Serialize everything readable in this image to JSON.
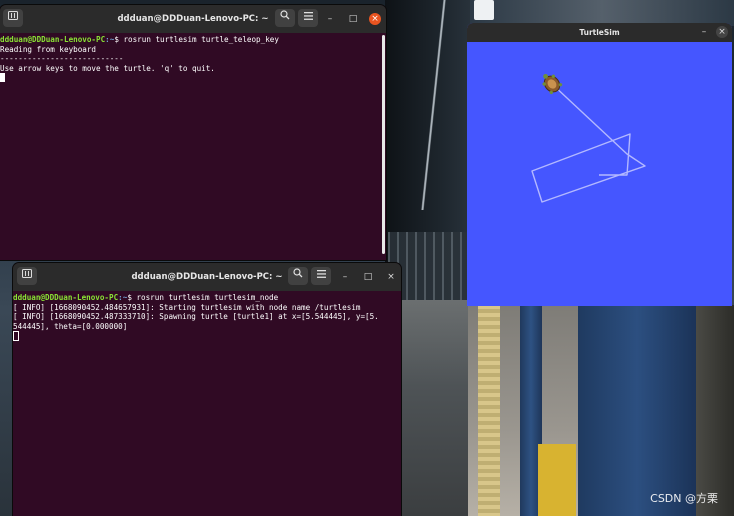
{
  "wallpaper": {
    "description_icon": "subway-station-photo"
  },
  "terminal_top": {
    "title": "ddduan@DDDuan-Lenovo-PC: ~",
    "prompt_user": "ddduan@DDDuan-Lenovo-PC",
    "prompt_path": ":~",
    "prompt_symbol": "$ ",
    "command": "rosrun turtlesim turtle_teleop_key",
    "lines": [
      "Reading from keyboard",
      "---------------------------",
      "Use arrow keys to move the turtle. 'q' to quit."
    ],
    "new_tab_icon": "terminal-new-tab-icon",
    "search_icon": "search-icon",
    "menu_icon": "hamburger-menu-icon",
    "minimize": "–",
    "maximize": "□",
    "close": "×"
  },
  "terminal_bottom": {
    "title": "ddduan@DDDuan-Lenovo-PC: ~",
    "prompt_user": "ddduan@DDDuan-Lenovo-PC",
    "prompt_path": ":~",
    "prompt_symbol": "$ ",
    "command": "rosrun turtlesim turtlesim_node",
    "lines": [
      "[ INFO] [1668090452.484657931]: Starting turtlesim with node name /turtlesim",
      "[ INFO] [1668090452.487333710]: Spawning turtle [turtle1] at x=[5.544445], y=[5.",
      "544445], theta=[0.000000]"
    ],
    "minimize": "–",
    "maximize": "□",
    "close": "×"
  },
  "turtlesim": {
    "title": "TurtleSim",
    "minimize": "–",
    "close": "×",
    "background_color": "#4556ff",
    "pen_color": "#b3b8ff",
    "turtle_icon": "turtle-icon"
  },
  "watermark": "CSDN @方栗"
}
